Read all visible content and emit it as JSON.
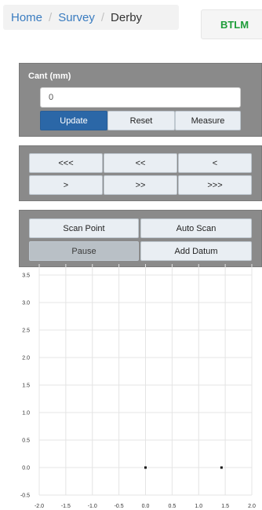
{
  "breadcrumb": {
    "home": "Home",
    "survey": "Survey",
    "current": "Derby",
    "separator": "/"
  },
  "brand_button": "BTLM",
  "cant_panel": {
    "label": "Cant (mm)",
    "input_value": "0",
    "buttons": {
      "update": "Update",
      "reset": "Reset",
      "measure": "Measure"
    }
  },
  "nav_panel": {
    "buttons": [
      "<<<",
      "<<",
      "<",
      ">",
      ">>",
      ">>>"
    ]
  },
  "scan_panel": {
    "buttons": {
      "scan_point": "Scan Point",
      "auto_scan": "Auto Scan",
      "pause": "Pause",
      "add_datum": "Add Datum"
    }
  },
  "colors": {
    "primary": "#2b67a7",
    "brand": "#1f9d3a",
    "panel": "#8a8a8a"
  },
  "chart_data": {
    "type": "scatter",
    "x_ticks": [
      "-2.0",
      "-1.5",
      "-1.0",
      "-0.5",
      "0.0",
      "0.5",
      "1.0",
      "1.5",
      "2.0"
    ],
    "y_ticks": [
      "-0.5",
      "0.0",
      "0.5",
      "1.0",
      "1.5",
      "2.0",
      "2.5",
      "3.0",
      "3.5"
    ],
    "xlim": [
      -2.0,
      2.0
    ],
    "ylim": [
      -0.5,
      3.7
    ],
    "grid": true,
    "points": [
      {
        "x": 0.0,
        "y": 0.0
      },
      {
        "x": 1.43,
        "y": 0.0
      }
    ]
  }
}
